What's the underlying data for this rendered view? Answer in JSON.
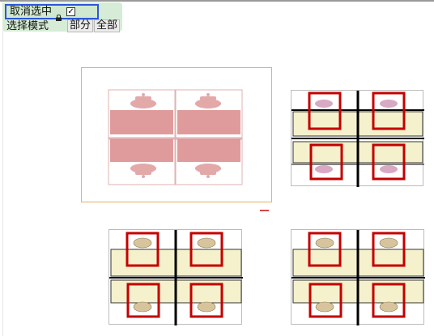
{
  "toolbar": {
    "cancel_label": "取消选中",
    "lock_icon": "lock-icon",
    "checkbox_checked": true,
    "checkmark": "✓",
    "select_mode_label": "选择模式",
    "mode_partial": "部分",
    "mode_all": "全部"
  },
  "colors": {
    "selection_frame": "#2d57d8",
    "toolbar_bg": "#d6ecd6",
    "selected_card_border": "#e5b262",
    "desk_fill": "#f4f1cc",
    "chair_frame": "#c40000",
    "chair_fill": "#d7c49c",
    "selected_overlay": "#d98a8a"
  },
  "layouts": [
    {
      "name": "workstation-4-selected",
      "selected": true
    },
    {
      "name": "workstation-4"
    },
    {
      "name": "workstation-4"
    },
    {
      "name": "workstation-4"
    }
  ]
}
